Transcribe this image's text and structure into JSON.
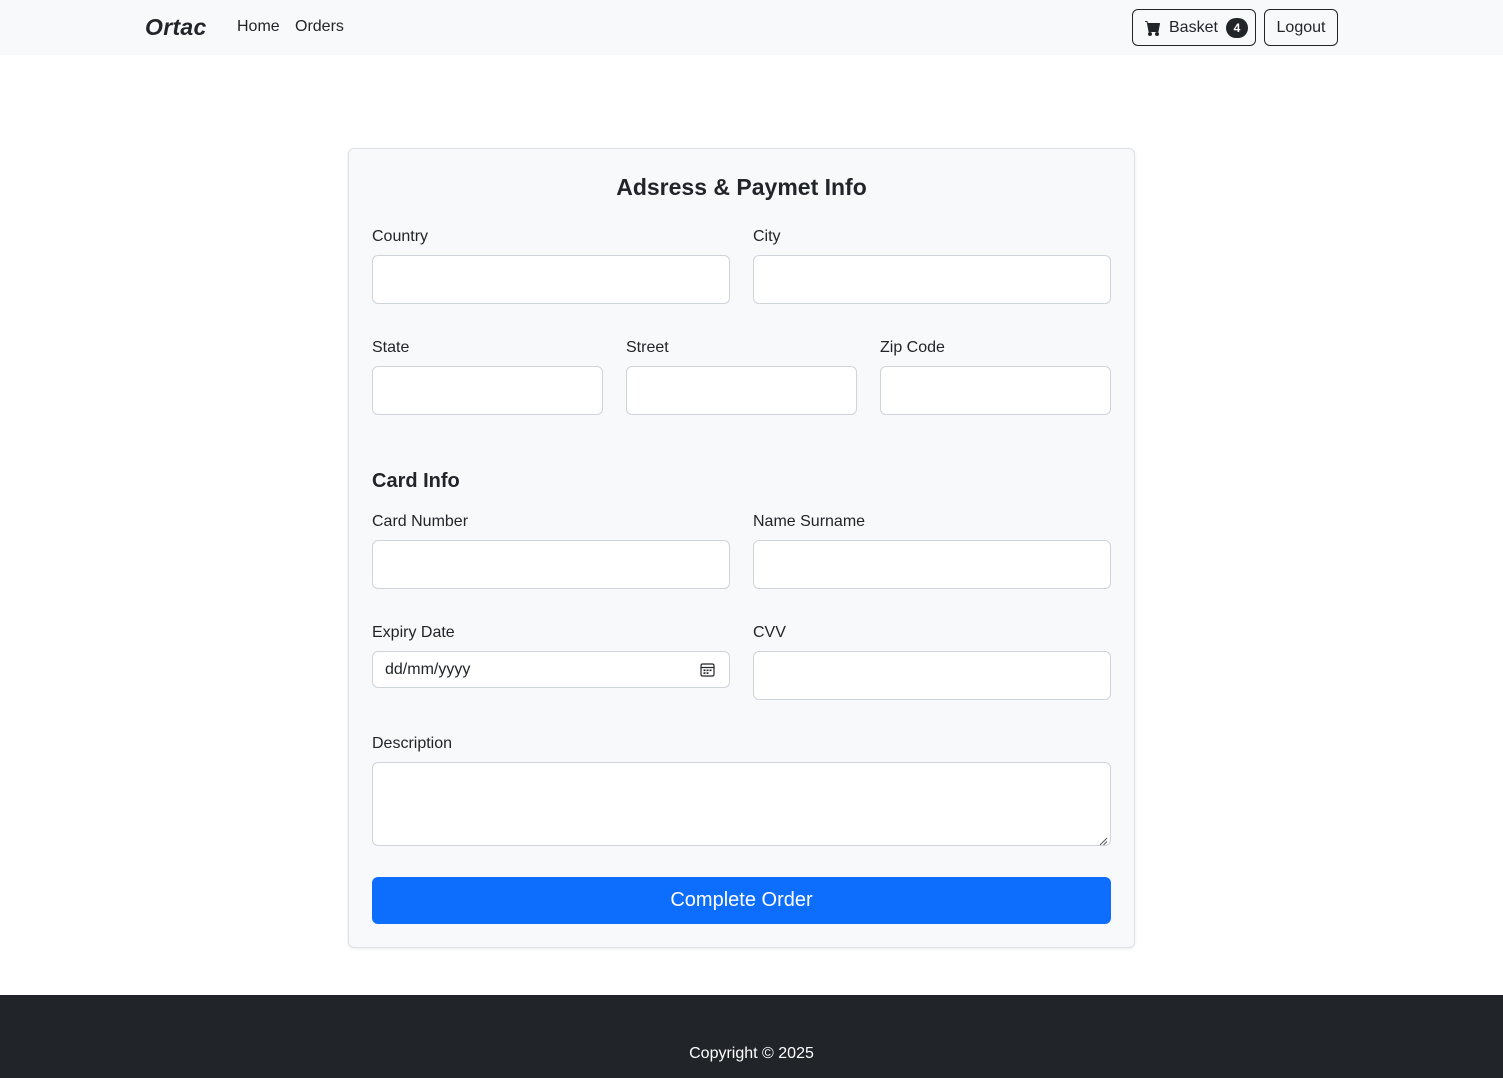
{
  "navbar": {
    "brand": "Ortac",
    "links": [
      "Home",
      "Orders"
    ],
    "basket_label": "Basket",
    "basket_count": "4",
    "logout_label": "Logout"
  },
  "form": {
    "title": "Adsress & Paymet Info",
    "country_label": "Country",
    "city_label": "City",
    "state_label": "State",
    "street_label": "Street",
    "zip_label": "Zip Code",
    "card_section_title": "Card Info",
    "card_number_label": "Card Number",
    "name_surname_label": "Name Surname",
    "expiry_label": "Expiry Date",
    "expiry_placeholder": "dd/mm/yyyy",
    "cvv_label": "CVV",
    "description_label": "Description",
    "submit_label": "Complete Order"
  },
  "footer": {
    "copyright": "Copyright © 2025"
  },
  "colors": {
    "primary": "#0d6efd",
    "dark": "#212529",
    "light": "#f8f9fa"
  }
}
